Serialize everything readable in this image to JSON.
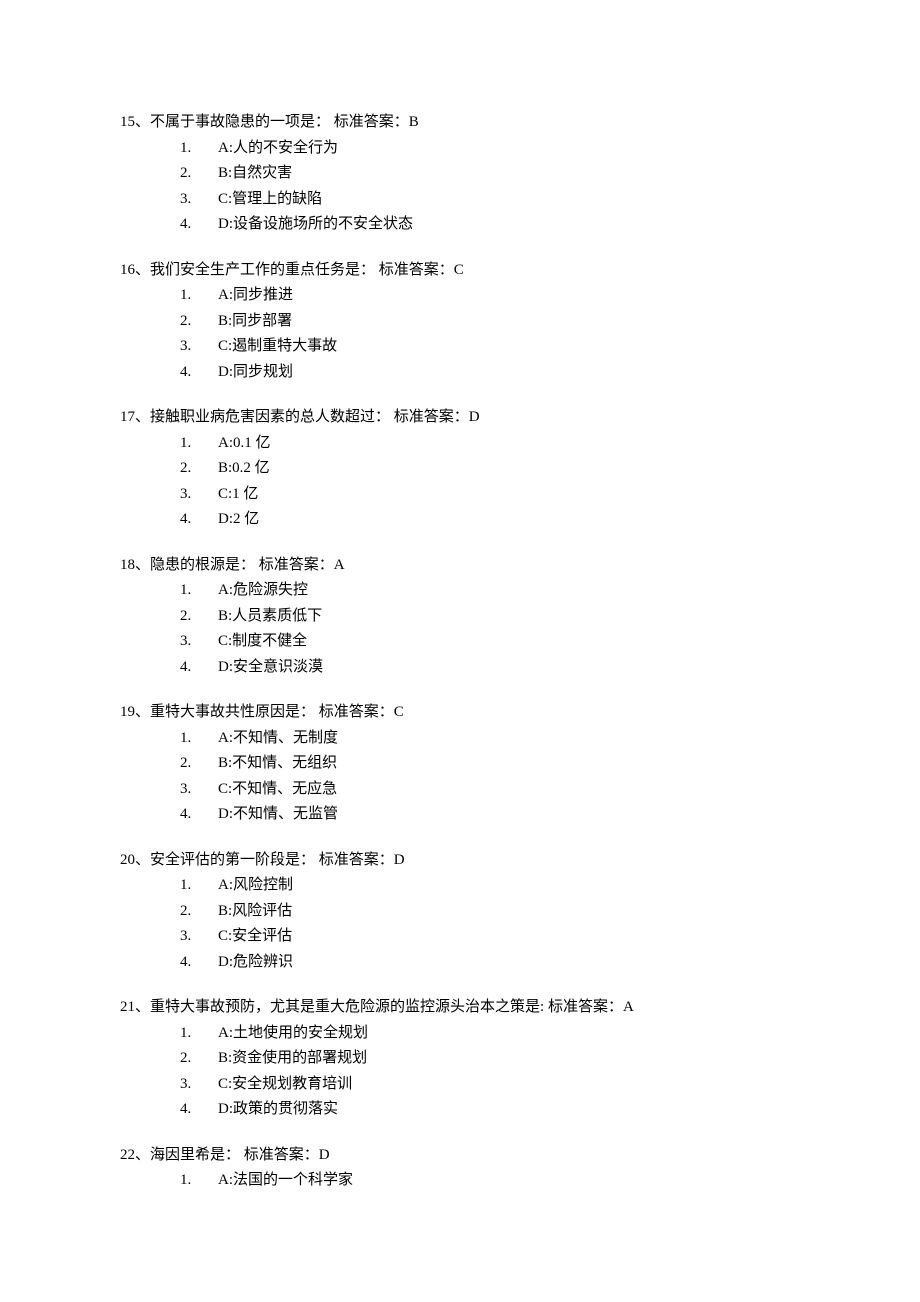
{
  "questions": [
    {
      "number": "15",
      "stem": "不属于事故隐患的一项是：",
      "answer_label": "标准答案：",
      "answer": "B",
      "options": [
        {
          "n": "1.",
          "text": "A:人的不安全行为"
        },
        {
          "n": "2.",
          "text": "B:自然灾害"
        },
        {
          "n": "3.",
          "text": "C:管理上的缺陷"
        },
        {
          "n": "4.",
          "text": "D:设备设施场所的不安全状态"
        }
      ]
    },
    {
      "number": "16",
      "stem": "我们安全生产工作的重点任务是：",
      "answer_label": "标准答案：",
      "answer": "C",
      "options": [
        {
          "n": "1.",
          "text": "A:同步推进"
        },
        {
          "n": "2.",
          "text": "B:同步部署"
        },
        {
          "n": "3.",
          "text": "C:遏制重特大事故"
        },
        {
          "n": "4.",
          "text": "D:同步规划"
        }
      ]
    },
    {
      "number": "17",
      "stem": "接触职业病危害因素的总人数超过：",
      "answer_label": "标准答案：",
      "answer": "D",
      "options": [
        {
          "n": "1.",
          "text": "A:0.1 亿"
        },
        {
          "n": "2.",
          "text": "B:0.2 亿"
        },
        {
          "n": "3.",
          "text": "C:1 亿"
        },
        {
          "n": "4.",
          "text": "D:2 亿"
        }
      ]
    },
    {
      "number": "18",
      "stem": "隐患的根源是：",
      "answer_label": "标准答案：",
      "answer": "A",
      "options": [
        {
          "n": "1.",
          "text": "A:危险源失控"
        },
        {
          "n": "2.",
          "text": "B:人员素质低下"
        },
        {
          "n": "3.",
          "text": "C:制度不健全"
        },
        {
          "n": "4.",
          "text": "D:安全意识淡漠"
        }
      ]
    },
    {
      "number": "19",
      "stem": "重特大事故共性原因是：",
      "answer_label": "标准答案：",
      "answer": "C",
      "options": [
        {
          "n": "1.",
          "text": "A:不知情、无制度"
        },
        {
          "n": "2.",
          "text": "B:不知情、无组织"
        },
        {
          "n": "3.",
          "text": "C:不知情、无应急"
        },
        {
          "n": "4.",
          "text": "D:不知情、无监管"
        }
      ]
    },
    {
      "number": "20",
      "stem": "安全评估的第一阶段是：",
      "answer_label": "标准答案：",
      "answer": "D",
      "options": [
        {
          "n": "1.",
          "text": "A:风险控制"
        },
        {
          "n": "2.",
          "text": "B:风险评估"
        },
        {
          "n": "3.",
          "text": "C:安全评估"
        },
        {
          "n": "4.",
          "text": "D:危险辨识"
        }
      ]
    },
    {
      "number": "21",
      "stem": "重特大事故预防，尤其是重大危险源的监控源头治本之策是:",
      "answer_label": "标准答案：",
      "answer": "A",
      "options": [
        {
          "n": "1.",
          "text": "A:土地使用的安全规划"
        },
        {
          "n": "2.",
          "text": "B:资金使用的部署规划"
        },
        {
          "n": "3.",
          "text": "C:安全规划教育培训"
        },
        {
          "n": "4.",
          "text": "D:政策的贯彻落实"
        }
      ]
    },
    {
      "number": "22",
      "stem": "海因里希是：",
      "answer_label": "标准答案：",
      "answer": "D",
      "options": [
        {
          "n": "1.",
          "text": "A:法国的一个科学家"
        }
      ]
    }
  ]
}
